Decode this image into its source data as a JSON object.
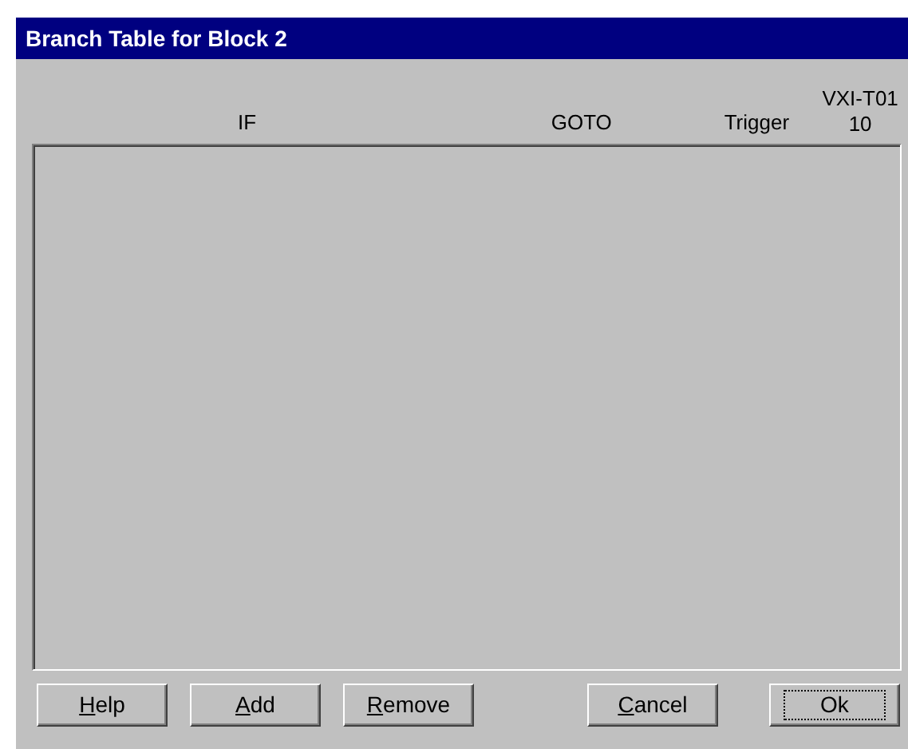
{
  "window": {
    "title": "Branch Table for Block 2"
  },
  "table": {
    "columns": [
      {
        "label": "IF"
      },
      {
        "label": "GOTO"
      },
      {
        "label": "Trigger"
      },
      {
        "label": "VXI-T01",
        "sublabel": "10"
      }
    ]
  },
  "buttons": [
    {
      "label": "Help",
      "underline_first": true,
      "focused": false
    },
    {
      "label": "Add",
      "underline_first": true,
      "focused": false
    },
    {
      "label": "Remove",
      "underline_first": true,
      "focused": false
    },
    {
      "label": "Cancel",
      "underline_first": true,
      "focused": false
    },
    {
      "label": "Ok",
      "underline_first": false,
      "focused": true
    }
  ]
}
